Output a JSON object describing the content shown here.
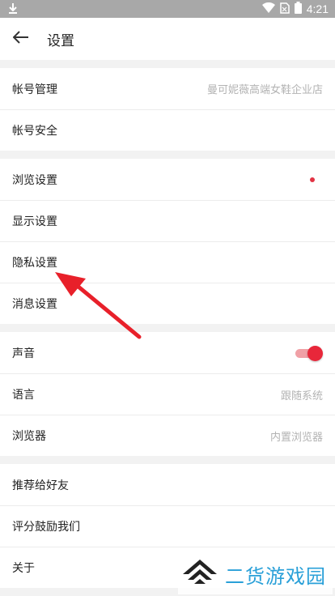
{
  "status_bar": {
    "time": "4:21",
    "icons": [
      "download-icon",
      "wifi-icon",
      "no-sim-icon",
      "battery-icon"
    ]
  },
  "header": {
    "title": "设置",
    "back_icon": "arrow-left-icon"
  },
  "groups": [
    {
      "rows": [
        {
          "label": "帐号管理",
          "value": "曼可妮薇高端女鞋企业店"
        },
        {
          "label": "帐号安全"
        }
      ]
    },
    {
      "rows": [
        {
          "label": "浏览设置",
          "badge": "red-dot"
        },
        {
          "label": "显示设置"
        },
        {
          "label": "隐私设置"
        },
        {
          "label": "消息设置"
        }
      ]
    },
    {
      "rows": [
        {
          "label": "声音",
          "toggle_on": true
        },
        {
          "label": "语言",
          "value": "跟随系统"
        },
        {
          "label": "浏览器",
          "value": "内置浏览器"
        }
      ]
    },
    {
      "rows": [
        {
          "label": "推荐给好友"
        },
        {
          "label": "评分鼓励我们"
        },
        {
          "label": "关于"
        }
      ]
    }
  ],
  "colors": {
    "accent": "#e23344",
    "annotation_arrow": "#e8202a",
    "status_bar": "#a8a8a8",
    "watermark": "#2aa0d8"
  },
  "watermark": {
    "text": "二货游戏园"
  }
}
